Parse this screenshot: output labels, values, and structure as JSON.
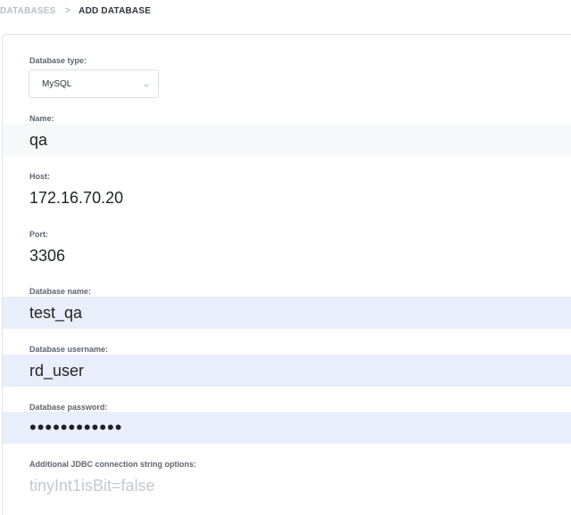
{
  "breadcrumb": {
    "parent": "DATABASES",
    "separator": ">",
    "current": "ADD DATABASE"
  },
  "form": {
    "database_type": {
      "label": "Database type:",
      "value": "MySQL"
    },
    "name": {
      "label": "Name:",
      "value": "qa"
    },
    "host": {
      "label": "Host:",
      "value": "172.16.70.20"
    },
    "port": {
      "label": "Port:",
      "value": "3306"
    },
    "database_name": {
      "label": "Database name:",
      "value": "test_qa"
    },
    "username": {
      "label": "Database username:",
      "value": "rd_user"
    },
    "password": {
      "label": "Database password:",
      "value": "••••••••••••"
    },
    "jdbc_options": {
      "label": "Additional JDBC connection string options:",
      "placeholder": "tinyInt1isBit=false"
    }
  },
  "colors": {
    "active_field_bg": "#e8effb",
    "hover_field_bg": "#f7f8f9",
    "breadcrumb_muted": "#b7c0c9"
  }
}
